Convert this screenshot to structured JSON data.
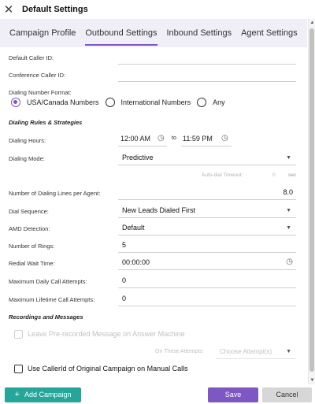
{
  "window": {
    "title": "Default Settings"
  },
  "tabs": [
    {
      "label": "Campaign Profile",
      "active": false
    },
    {
      "label": "Outbound Settings",
      "active": true
    },
    {
      "label": "Inbound Settings",
      "active": false
    },
    {
      "label": "Agent Settings",
      "active": false
    }
  ],
  "fields": {
    "default_caller_id": {
      "label": "Default Caller ID:",
      "value": ""
    },
    "conference_caller_id": {
      "label": "Conference Caller ID:",
      "value": ""
    }
  },
  "dialing_number_format": {
    "label": "Dialing Number Format:",
    "options": [
      "USA/Canada Numbers",
      "International Numbers",
      "Any"
    ],
    "selected": "USA/Canada Numbers"
  },
  "sections": {
    "dialing_rules": "Dialing Rules & Strategies",
    "recordings": "Recordings and Messages"
  },
  "dialing_hours": {
    "label": "Dialing Hours:",
    "start": "12:00 AM",
    "separator": "to",
    "end": "11:59 PM"
  },
  "dialing_mode": {
    "label": "Dialing Mode:",
    "value": "Predictive"
  },
  "auto_dial_timeout": {
    "label": "Auto-dial Timeout:",
    "value": "0",
    "unit": "sec"
  },
  "lines_per_agent": {
    "label": "Number of Dialing Lines per Agent:",
    "value": "8.0"
  },
  "dial_sequence": {
    "label": "Dial Sequence:",
    "value": "New Leads Dialed First"
  },
  "amd_detection": {
    "label": "AMD Detection:",
    "value": "Default"
  },
  "number_of_rings": {
    "label": "Number of Rings:",
    "value": "5"
  },
  "redial_wait_time": {
    "label": "Redial Wait Time:",
    "value": "00:00:00"
  },
  "max_daily_attempts": {
    "label": "Maximum Daily Call Attempts:",
    "value": "0"
  },
  "max_lifetime_attempts": {
    "label": "Maximum Lifetime Call Attempts:",
    "value": "0"
  },
  "answer_machine": {
    "label": "Leave Pre-recorded Message on Answer Machine",
    "checked": false,
    "disabled": true
  },
  "on_these_attempts": {
    "label": "On These Attempts:",
    "placeholder": "Choose Attempt(s)"
  },
  "caller_id_original": {
    "label": "Use CallerId of Original Campaign on Manual Calls",
    "checked": false
  },
  "footer": {
    "add_campaign": "Add Campaign",
    "save": "Save",
    "cancel": "Cancel"
  },
  "colors": {
    "accent": "#7e57c2",
    "add_button": "#26a69a",
    "cancel_button": "#d7d7d7"
  }
}
